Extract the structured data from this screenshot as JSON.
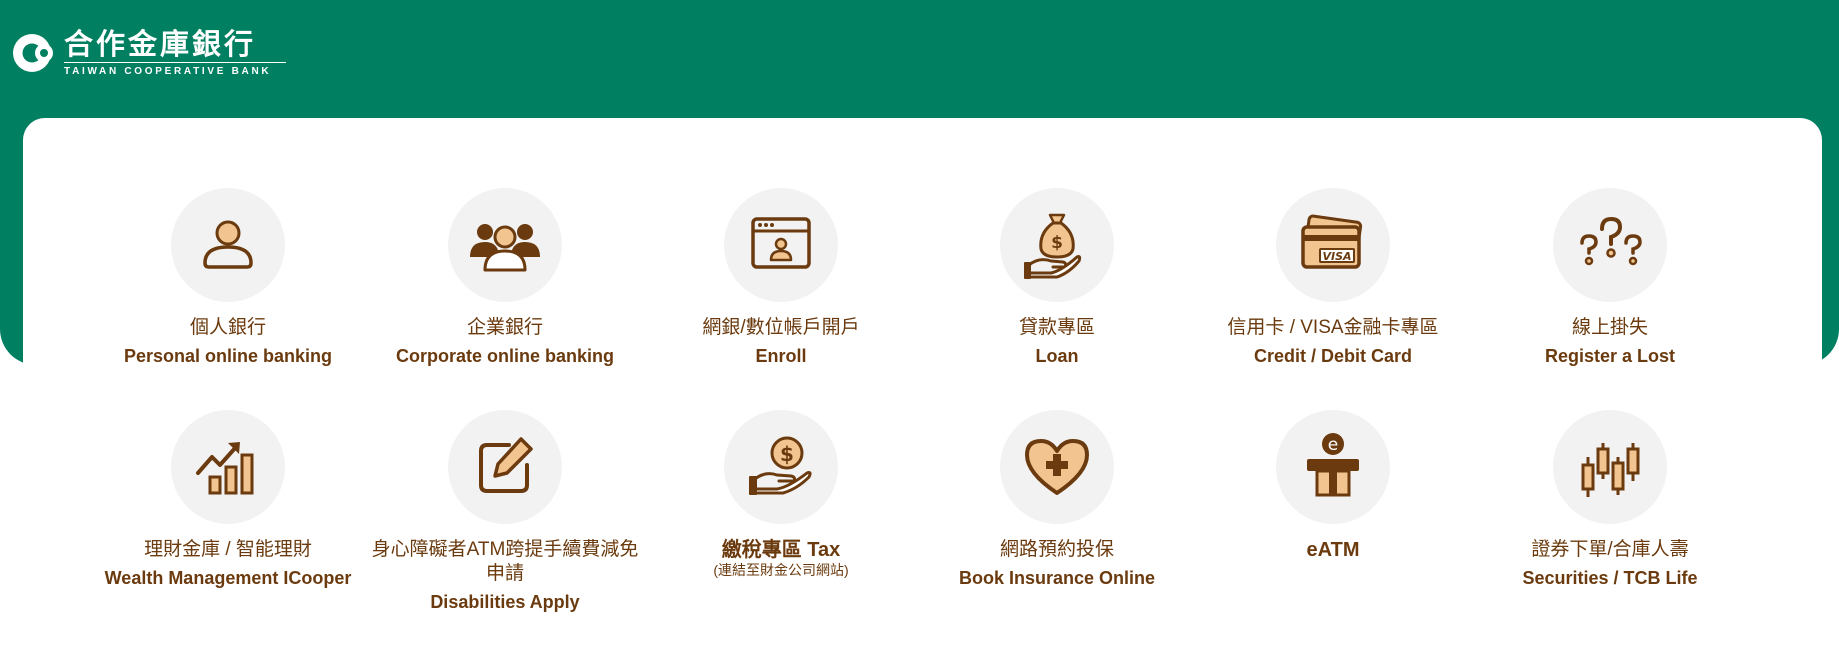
{
  "brand": {
    "name_cn": "合作金庫銀行",
    "name_en": "TAIWAN COOPERATIVE BANK"
  },
  "colors": {
    "brand_green": "#017f61",
    "label_brown": "#6b3b0f",
    "icon_brown": "#6b3b0f",
    "icon_orange": "#f2c590",
    "icon_bg": "#f2f2f2"
  },
  "services": [
    {
      "icon": "person-icon",
      "cn": "個人銀行",
      "en": "Personal online banking"
    },
    {
      "icon": "group-icon",
      "cn": "企業銀行",
      "en": "Corporate online banking"
    },
    {
      "icon": "browser-account-icon",
      "cn": "網銀/數位帳戶開戶",
      "en": "Enroll"
    },
    {
      "icon": "money-bag-hand-icon",
      "cn": "貸款專區",
      "en": "Loan"
    },
    {
      "icon": "credit-card-icon",
      "cn": "信用卡 / VISA金融卡專區",
      "en": "Credit / Debit Card"
    },
    {
      "icon": "question-marks-icon",
      "cn": "線上掛失",
      "en": "Register a Lost"
    },
    {
      "icon": "growth-chart-icon",
      "cn": "理財金庫 / 智能理財",
      "en": "Wealth Management ICooper"
    },
    {
      "icon": "edit-icon",
      "cn": "身心障礙者ATM跨提手續費減免申請",
      "en": "Disabilities Apply"
    },
    {
      "icon": "coin-hand-icon",
      "cn": "繳稅專區 Tax",
      "sub": "(連結至財金公司網站)",
      "en": ""
    },
    {
      "icon": "heart-plus-icon",
      "cn": "網路預約投保",
      "en": "Book Insurance Online"
    },
    {
      "icon": "eatm-icon",
      "cn": "eATM",
      "en": ""
    },
    {
      "icon": "candlestick-icon",
      "cn": "證券下單/合庫人壽",
      "en": "Securities / TCB Life"
    }
  ]
}
